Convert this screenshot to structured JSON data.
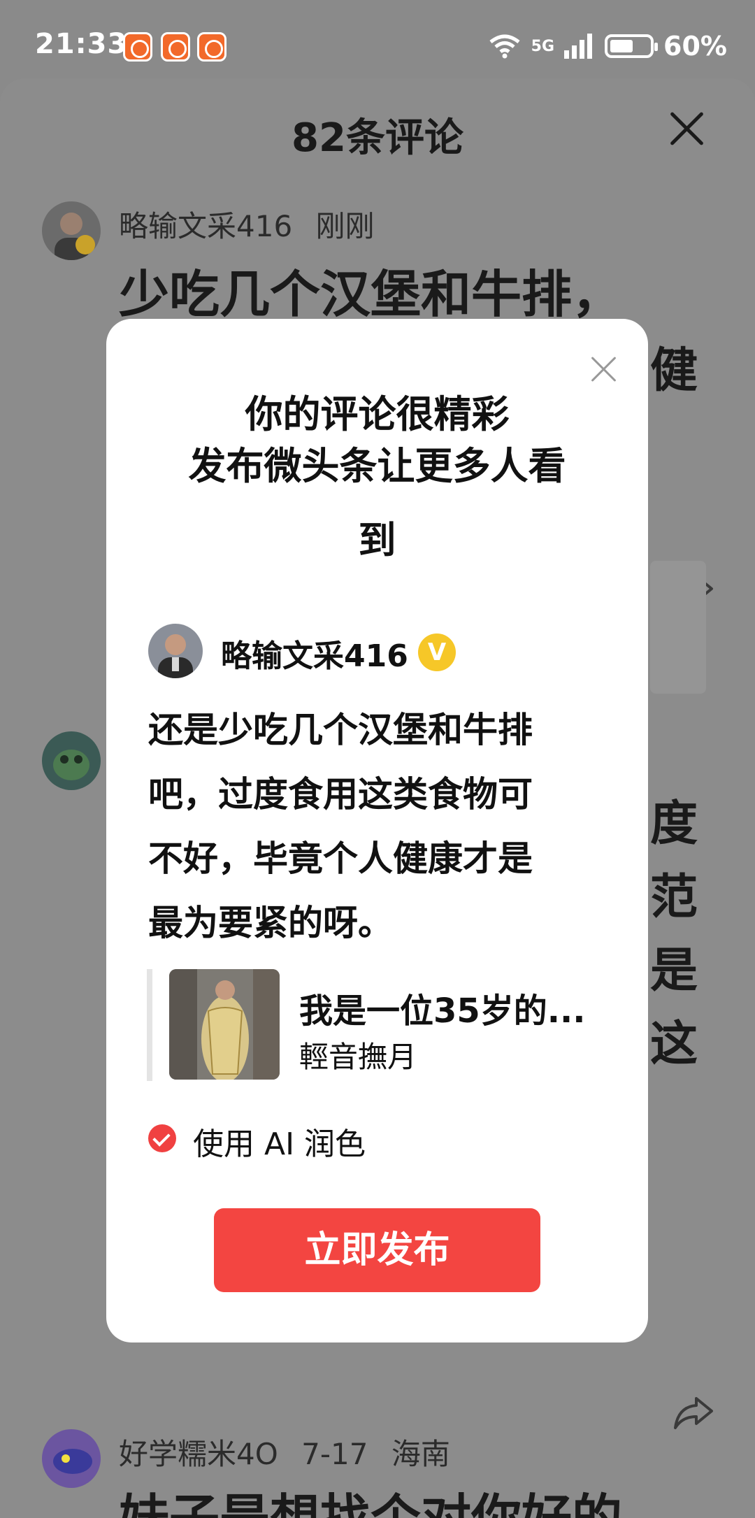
{
  "status_bar": {
    "time": "21:33",
    "network": "5G",
    "battery": "60%"
  },
  "sheet": {
    "title": "82条评论",
    "comments": [
      {
        "author": "略输文采416",
        "time": "刚刚",
        "text_line1": "少吃几个汉堡和牛排，",
        "text_fragment": "健"
      },
      {
        "frag1": "度",
        "frag2": "范",
        "frag3": "是",
        "frag4": "这"
      },
      {
        "author": "好学糯米4O",
        "time": "7-17",
        "location": "海南",
        "text_line1": "妹子是想找个对你好的"
      }
    ]
  },
  "modal": {
    "title_line1": "你的评论很精彩",
    "title_line2": "发布微头条让更多人看",
    "title_line3": "到",
    "author": "略输文采416",
    "verified_badge": "V",
    "comment_lines": [
      "还是少吃几个汉堡和牛排",
      "吧，过度食用这类食物可",
      "不好，毕竟个人健康才是",
      "最为要紧的呀。"
    ],
    "quote": {
      "title": "我是一位35岁的...",
      "author": "輕音撫月"
    },
    "ai_polish_label": "使用 AI 润色",
    "publish_button": "立即发布"
  },
  "colors": {
    "accent_red": "#f34541",
    "overlay_gray": "#8a8a8a",
    "verified_yellow": "#f6c728"
  }
}
